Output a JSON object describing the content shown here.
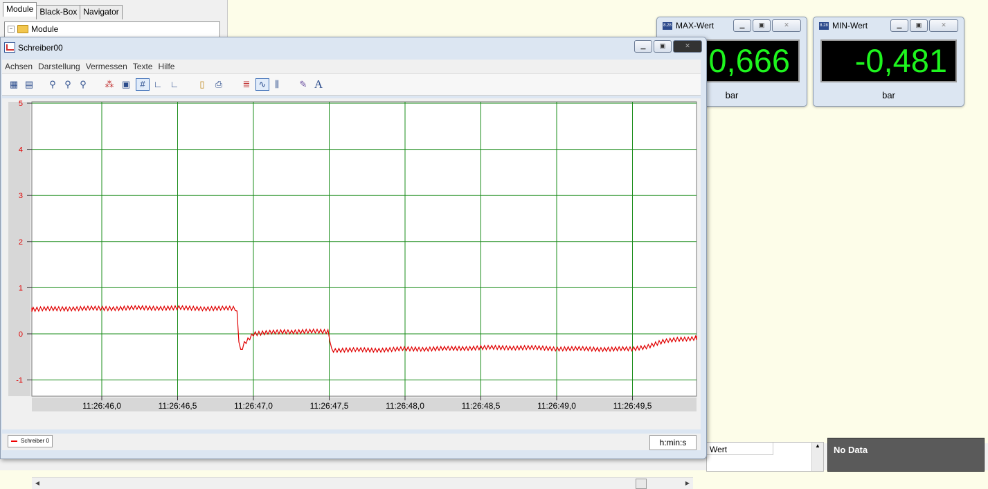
{
  "module_panel": {
    "tabs": [
      "Module",
      "Black-Box",
      "Navigator"
    ],
    "tree_root": "Module"
  },
  "max_window": {
    "title": "MAX-Wert",
    "icon_text": "8.28",
    "value": "0,666",
    "unit": "bar"
  },
  "min_window": {
    "title": "MIN-Wert",
    "icon_text": "8.28",
    "value": "-0,481",
    "unit": "bar"
  },
  "schreiber": {
    "title": "Schreiber00",
    "menu": [
      "Achsen",
      "Darstellung",
      "Vermessen",
      "Texte",
      "Hilfe"
    ],
    "legend": "Schreiber 0",
    "time_unit": "h:min:s"
  },
  "table": {
    "header": "Wert"
  },
  "no_data": "No Data",
  "colors": {
    "grid": "#1a8c1a",
    "trace": "#e00000",
    "axis_label": "#e00000",
    "digit": "#1ef51e"
  },
  "chart_data": {
    "type": "line",
    "series": [
      {
        "name": "Schreiber 0",
        "color": "#e00000",
        "x": [
          "11:26:45,5",
          "11:26:45,8",
          "11:26:46,0",
          "11:26:46,2",
          "11:26:46,5",
          "11:26:46,7",
          "11:26:46,89",
          "11:26:46,91",
          "11:26:46,94",
          "11:26:47,0",
          "11:26:47,2",
          "11:26:47,4",
          "11:26:47,5",
          "11:26:47,51",
          "11:26:47,8",
          "11:26:48,0",
          "11:26:48,3",
          "11:26:48,5",
          "11:26:48,8",
          "11:26:49,0",
          "11:26:49,3",
          "11:26:49,5",
          "11:26:49,6",
          "11:26:49,7",
          "11:26:49,8",
          "11:26:49,95"
        ],
        "y": [
          0.53,
          0.55,
          0.55,
          0.56,
          0.56,
          0.55,
          0.55,
          -0.42,
          -0.2,
          0.0,
          0.05,
          0.05,
          0.05,
          -0.35,
          -0.35,
          -0.33,
          -0.32,
          -0.3,
          -0.3,
          -0.32,
          -0.33,
          -0.33,
          -0.27,
          -0.17,
          -0.12,
          -0.08
        ]
      }
    ],
    "x_ticks": [
      "11:26:46,0",
      "11:26:46,5",
      "11:26:47,0",
      "11:26:47,5",
      "11:26:48,0",
      "11:26:48,5",
      "11:26:49,0",
      "11:26:49,5"
    ],
    "y_ticks": [
      "5",
      "4",
      "3",
      "2",
      "1",
      "0",
      "-1"
    ],
    "ylim": [
      -1,
      5
    ],
    "grid": true
  }
}
